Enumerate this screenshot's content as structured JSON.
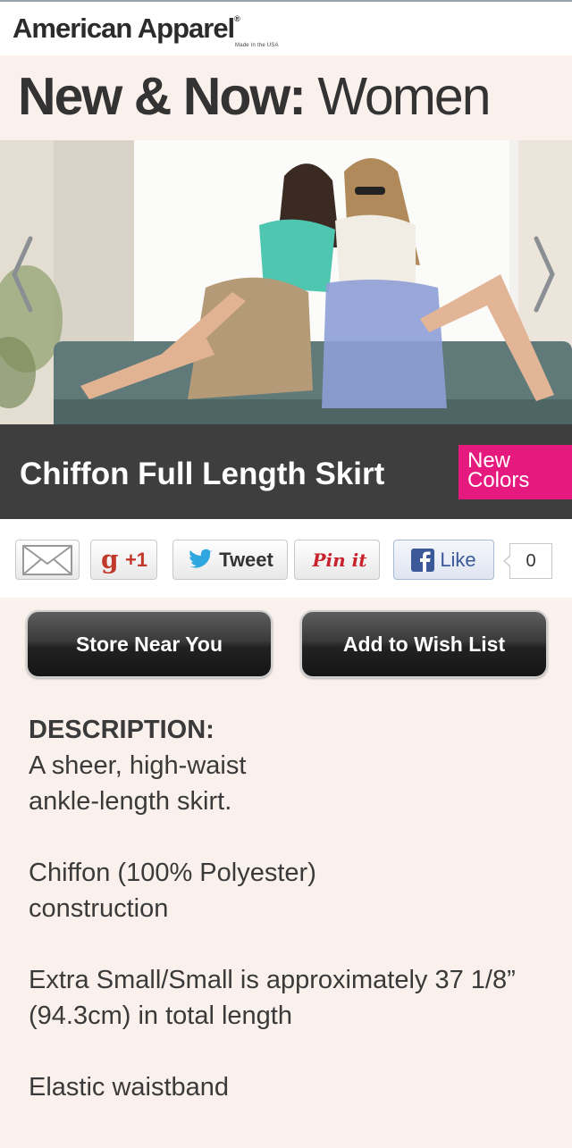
{
  "brand": {
    "name": "American Apparel",
    "tagline": "Made In the USA"
  },
  "page": {
    "title_bold": "New & Now:",
    "title_light": "Women"
  },
  "product": {
    "title": "Chiffon Full Length Skirt",
    "badge": "New Colors"
  },
  "share": {
    "gplus_label": "+1",
    "tweet_label": "Tweet",
    "pin_label": "Pin it",
    "like_label": "Like",
    "like_count": "0"
  },
  "actions": {
    "store": "Store Near You",
    "wishlist": "Add to Wish List"
  },
  "description": {
    "heading": "DESCRIPTION:",
    "paragraphs": [
      "A sheer, high-waist ankle-length skirt.",
      "Chiffon (100% Polyester) construction",
      "Extra Small/Small is approximately 37 1/8” (94.3cm) in total length",
      "Elastic waistband"
    ]
  },
  "colors": {
    "badge": "#e6197e",
    "title_bar": "#3e3e3e",
    "background": "#fbf1ec"
  },
  "icons": [
    "mail-icon",
    "google-plus-icon",
    "twitter-bird-icon",
    "facebook-icon",
    "chevron-left-icon",
    "chevron-right-icon"
  ]
}
